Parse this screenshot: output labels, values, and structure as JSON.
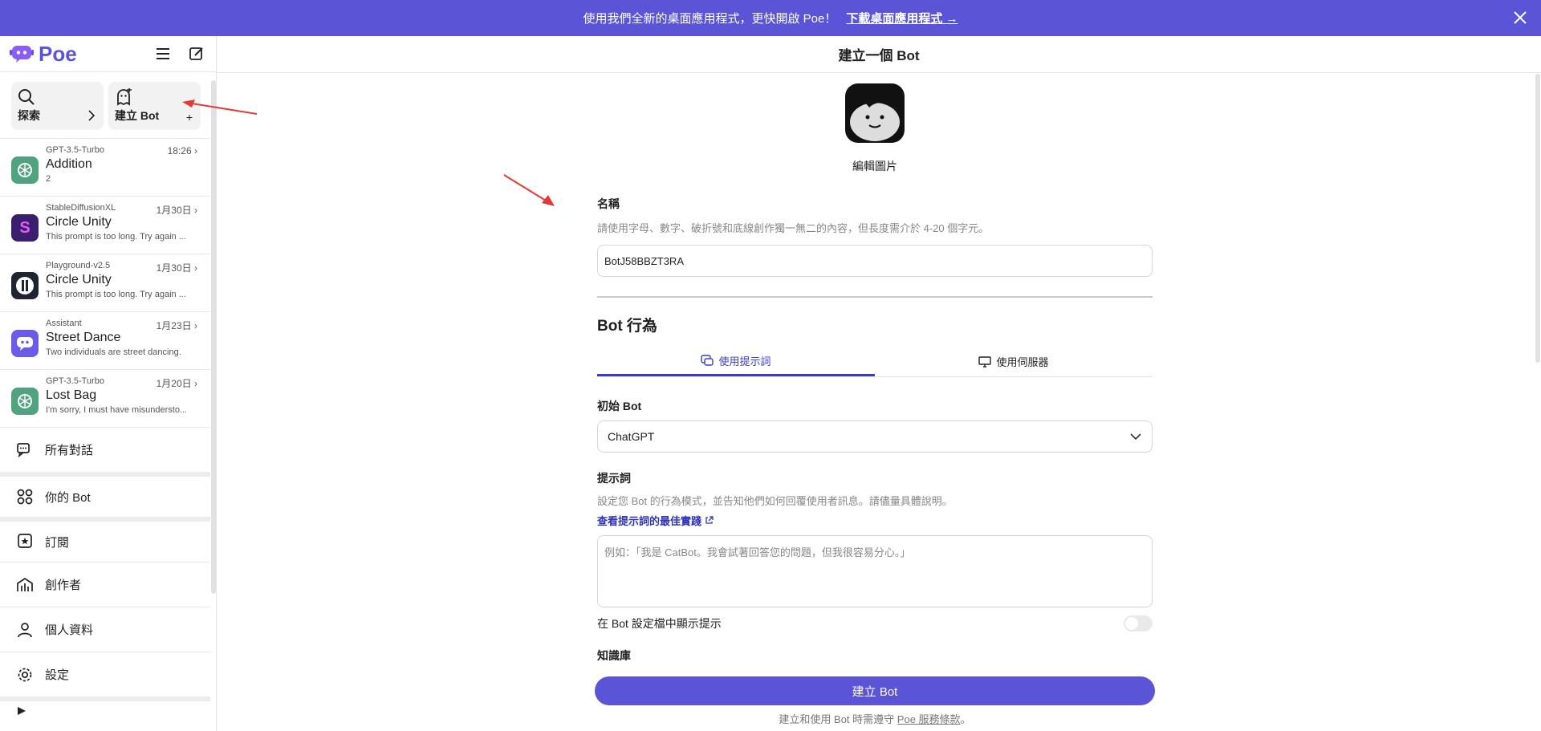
{
  "banner": {
    "text": "使用我們全新的桌面應用程式，更快開啟 Poe！",
    "link": "下載桌面應用程式 →",
    "color": "#5b54d6"
  },
  "sidebar": {
    "logo": "Poe",
    "explore_label": "探索",
    "create_bot_label": "建立 Bot",
    "create_bot_plus": "+",
    "chats": [
      {
        "model": "GPT-3.5-Turbo",
        "title": "Addition",
        "preview": "2",
        "date": "18:26",
        "icon": "openai-icon"
      },
      {
        "model": "StableDiffusionXL",
        "title": "Circle Unity",
        "preview": "This prompt is too long. Try again ...",
        "date": "1月30日",
        "icon": "stable-diffusion-icon"
      },
      {
        "model": "Playground-v2.5",
        "title": "Circle Unity",
        "preview": "This prompt is too long. Try again ...",
        "date": "1月30日",
        "icon": "playground-icon"
      },
      {
        "model": "Assistant",
        "title": "Street Dance",
        "preview": "Two individuals are street dancing.",
        "date": "1月23日",
        "icon": "assistant-icon"
      },
      {
        "model": "GPT-3.5-Turbo",
        "title": "Lost Bag",
        "preview": "I'm sorry, I must have misundersto...",
        "date": "1月20日",
        "icon": "openai-icon"
      }
    ],
    "nav": {
      "all_chats": "所有對話",
      "your_bots": "你的 Bot",
      "subscribe": "訂閱",
      "creators": "創作者",
      "profile": "個人資料",
      "settings": "設定"
    }
  },
  "main": {
    "header_title": "建立一個 Bot",
    "edit_image": "編輯圖片",
    "name_label": "名稱",
    "name_hint": "請使用字母、數字、破折號和底線創作獨一無二的內容，但長度需介於 4-20 個字元。",
    "name_value": "BotJ58BBZT3RA",
    "behavior_title": "Bot 行為",
    "tab_prompt": "使用提示詞",
    "tab_server": "使用伺服器",
    "base_bot_label": "初始 Bot",
    "base_bot_value": "ChatGPT",
    "prompt_label": "提示詞",
    "prompt_hint": "設定您 Bot 的行為模式，並告知他們如何回覆使用者訊息。請儘量具體說明。",
    "prompt_link": "查看提示詞的最佳實踐",
    "prompt_placeholder": "例如：「我是 CatBot。我會試著回答您的問題，但我很容易分心。」",
    "show_prompt_label": "在 Bot 設定檔中顯示提示",
    "knowledge_label": "知識庫",
    "create_button": "建立 Bot",
    "terms_prefix": "建立和使用 Bot 時需遵守",
    "terms_link": "Poe 服務條款",
    "terms_suffix": "。"
  }
}
